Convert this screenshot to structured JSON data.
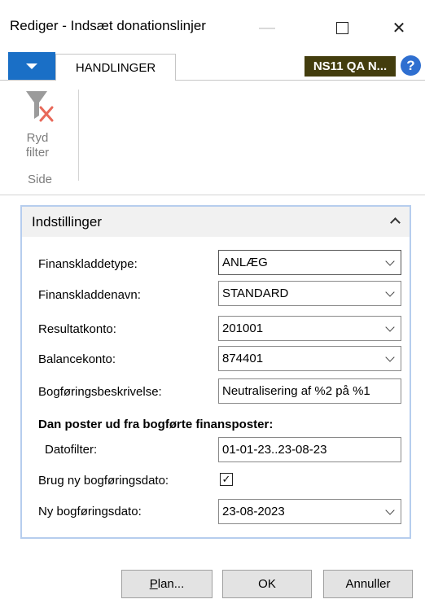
{
  "window": {
    "title": "Rediger - Indsæt donationslinjer",
    "minimize_glyph": "—",
    "close_glyph": "✕"
  },
  "ribbon": {
    "tab_label": "HANDLINGER",
    "company_badge": "NS11 QA N...",
    "help_glyph": "?",
    "clear_filter_line1": "Ryd",
    "clear_filter_line2": "filter",
    "group_label": "Side"
  },
  "panel": {
    "title": "Indstillinger",
    "fields": {
      "journal_type_label": "Finanskladdetype:",
      "journal_type_value": "ANLÆG",
      "journal_name_label": "Finanskladdenavn:",
      "journal_name_value": "STANDARD",
      "result_account_label": "Resultatkonto:",
      "result_account_value": "201001",
      "balance_account_label": "Balancekonto:",
      "balance_account_value": "874401",
      "posting_desc_label": "Bogføringsbeskrivelse:",
      "posting_desc_value": "Neutralisering af %2 på %1",
      "section_heading": "Dan poster ud fra bogførte finansposter:",
      "date_filter_label": "Datofilter:",
      "date_filter_value": "01-01-23..23-08-23",
      "use_new_date_label": "Brug ny bogføringsdato:",
      "use_new_date_checked": true,
      "new_date_label": "Ny bogføringsdato:",
      "new_date_value": "23-08-2023"
    }
  },
  "footer": {
    "plan_first_letter": "P",
    "plan_rest": "lan...",
    "ok_label": "OK",
    "cancel_label": "Annuller"
  },
  "colors": {
    "menu_button": "#1a6fc6",
    "company_badge_bg": "#433d0e",
    "help_bg": "#2f6fd0",
    "panel_border": "#b6cdee"
  }
}
